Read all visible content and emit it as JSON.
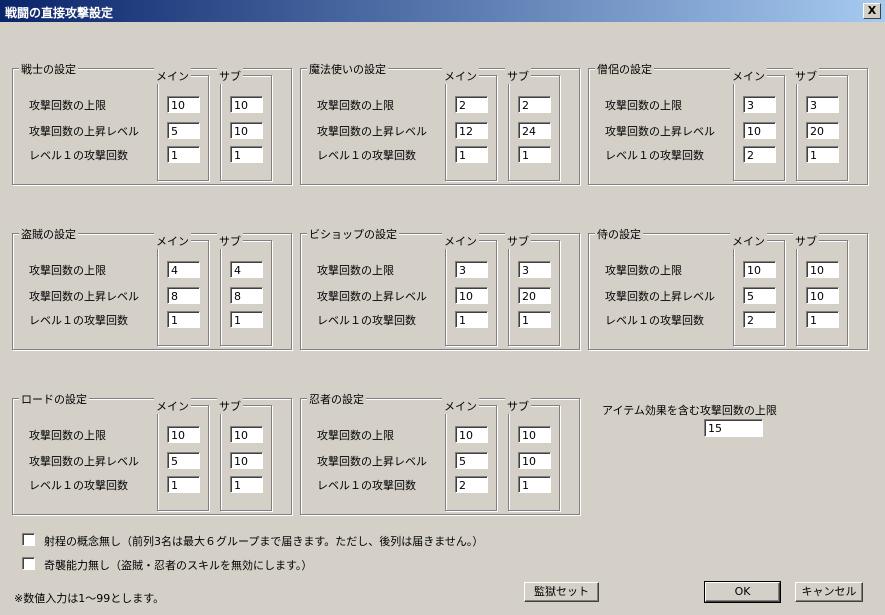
{
  "window": {
    "title": "戦闘の直接攻撃設定",
    "close": "X"
  },
  "labels": {
    "max": "攻撃回数の上限",
    "increase": "攻撃回数の上昇レベル",
    "level1": "レベル１の攻撃回数",
    "main": "メイン",
    "sub": "サブ"
  },
  "classes": [
    {
      "title": "戦士の設定",
      "main": [
        "10",
        "5",
        "1"
      ],
      "sub": [
        "10",
        "10",
        "1"
      ]
    },
    {
      "title": "魔法使いの設定",
      "main": [
        "2",
        "12",
        "1"
      ],
      "sub": [
        "2",
        "24",
        "1"
      ]
    },
    {
      "title": "僧侶の設定",
      "main": [
        "3",
        "10",
        "2"
      ],
      "sub": [
        "3",
        "20",
        "1"
      ]
    },
    {
      "title": "盗賊の設定",
      "main": [
        "4",
        "8",
        "1"
      ],
      "sub": [
        "4",
        "8",
        "1"
      ]
    },
    {
      "title": "ビショップの設定",
      "main": [
        "3",
        "10",
        "1"
      ],
      "sub": [
        "3",
        "20",
        "1"
      ]
    },
    {
      "title": "侍の設定",
      "main": [
        "10",
        "5",
        "2"
      ],
      "sub": [
        "10",
        "10",
        "1"
      ]
    },
    {
      "title": "ロードの設定",
      "main": [
        "10",
        "5",
        "1"
      ],
      "sub": [
        "10",
        "10",
        "1"
      ]
    },
    {
      "title": "忍者の設定",
      "main": [
        "10",
        "5",
        "2"
      ],
      "sub": [
        "10",
        "10",
        "1"
      ]
    }
  ],
  "item_limit": {
    "label": "アイテム効果を含む攻撃回数の上限",
    "value": "15"
  },
  "options": [
    {
      "label": "射程の概念無し（前列3名は最大６グループまで届きます。ただし、後列は届きません。）",
      "checked": false
    },
    {
      "label": "奇襲能力無し（盗賊・忍者のスキルを無効にします。）",
      "checked": false
    }
  ],
  "note": "※数値入力は1～99とします。",
  "buttons": {
    "preset": "監獄セット",
    "ok": "OK",
    "cancel": "キャンセル"
  }
}
